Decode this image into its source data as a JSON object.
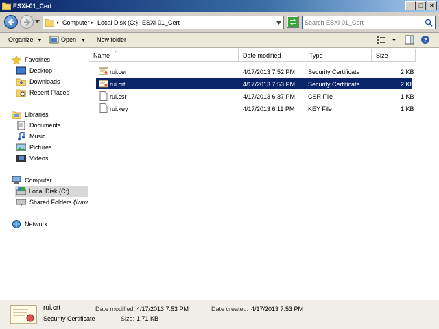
{
  "window": {
    "title": "ESXi-01_Cert"
  },
  "address": {
    "crumbs": [
      "Computer",
      "Local Disk (C:)",
      "ESXi-01_Cert"
    ]
  },
  "search": {
    "placeholder": "Search ESXi-01_Cert"
  },
  "toolbar": {
    "organize": "Organize",
    "open": "Open",
    "new_folder": "New folder"
  },
  "nav": {
    "favorites": "Favorites",
    "desktop": "Desktop",
    "downloads": "Downloads",
    "recent": "Recent Places",
    "libraries": "Libraries",
    "documents": "Documents",
    "music": "Music",
    "pictures": "Pictures",
    "videos": "Videos",
    "computer": "Computer",
    "local_disk": "Local Disk (C:)",
    "shared": "Shared Folders (\\\\vmw",
    "network": "Network"
  },
  "columns": {
    "name": "Name",
    "date": "Date modified",
    "type": "Type",
    "size": "Size"
  },
  "files": [
    {
      "name": "rui.cer",
      "date": "4/17/2013 7:52 PM",
      "type": "Security Certificate",
      "size": "2 KB"
    },
    {
      "name": "rui.crt",
      "date": "4/17/2013 7:53 PM",
      "type": "Security Certificate",
      "size": "2 KB"
    },
    {
      "name": "rui.csr",
      "date": "4/17/2013 6:37 PM",
      "type": "CSR File",
      "size": "1 KB"
    },
    {
      "name": "rui.key",
      "date": "4/17/2013 6:11 PM",
      "type": "KEY File",
      "size": "1 KB"
    }
  ],
  "details": {
    "name": "rui.crt",
    "type": "Security Certificate",
    "modified_label": "Date modified:",
    "modified": "4/17/2013 7:53 PM",
    "created_label": "Date created:",
    "created": "4/17/2013 7:53 PM",
    "size_label": "Size:",
    "size": "1.71 KB"
  }
}
